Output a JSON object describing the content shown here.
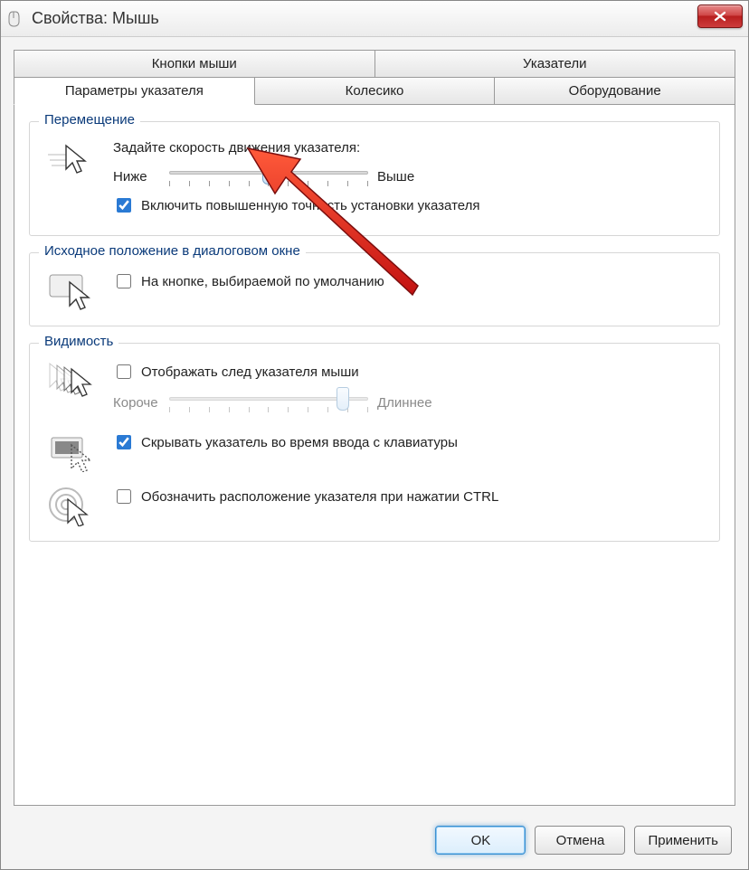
{
  "window": {
    "title": "Свойства: Мышь"
  },
  "tabs": {
    "top": [
      {
        "label": "Кнопки мыши"
      },
      {
        "label": "Указатели"
      }
    ],
    "bottom": [
      {
        "label": "Параметры указателя",
        "active": true
      },
      {
        "label": "Колесико"
      },
      {
        "label": "Оборудование"
      }
    ]
  },
  "group_motion": {
    "legend": "Перемещение",
    "speed_label": "Задайте скорость движения указателя:",
    "slider_low": "Ниже",
    "slider_high": "Выше",
    "slider_value": 5,
    "slider_max": 10,
    "enhance_label": "Включить повышенную точность установки указателя",
    "enhance_checked": true
  },
  "group_snap": {
    "legend": "Исходное положение в диалоговом окне",
    "snap_label": "На кнопке, выбираемой по умолчанию",
    "snap_checked": false
  },
  "group_visibility": {
    "legend": "Видимость",
    "trails_label": "Отображать след указателя мыши",
    "trails_checked": false,
    "trail_low": "Короче",
    "trail_high": "Длиннее",
    "trail_value": 9,
    "trail_max": 10,
    "hide_label": "Скрывать указатель во время ввода с клавиатуры",
    "hide_checked": true,
    "ctrl_label": "Обозначить расположение указателя при нажатии CTRL",
    "ctrl_checked": false
  },
  "buttons": {
    "ok": "OK",
    "cancel": "Отмена",
    "apply": "Применить"
  }
}
